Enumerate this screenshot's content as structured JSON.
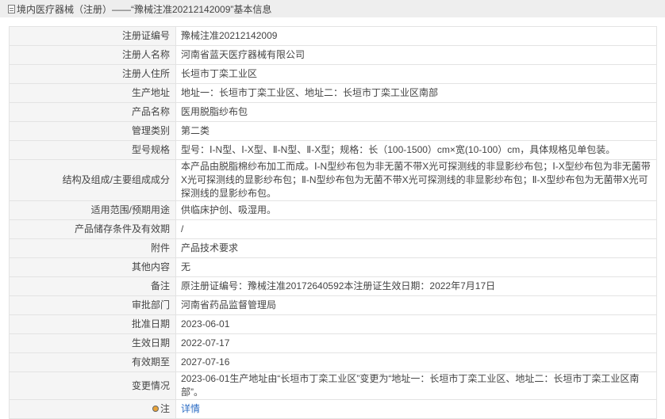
{
  "header": {
    "title": "境内医疗器械（注册）——“豫械注准20212142009”基本信息",
    "icon": "document-icon"
  },
  "rows": [
    {
      "label": "注册证编号",
      "value": "豫械注准20212142009"
    },
    {
      "label": "注册人名称",
      "value": "河南省蓝天医疗器械有限公司"
    },
    {
      "label": "注册人住所",
      "value": "长垣市丁栾工业区"
    },
    {
      "label": "生产地址",
      "value": "地址一：长垣市丁栾工业区、地址二：长垣市丁栾工业区南部"
    },
    {
      "label": "产品名称",
      "value": "医用脱脂纱布包"
    },
    {
      "label": "管理类别",
      "value": "第二类"
    },
    {
      "label": "型号规格",
      "value": "型号：Ⅰ-N型、Ⅰ-X型、Ⅱ-N型、Ⅱ-X型；规格：长（100-1500）cm×宽(10-100）cm，具体规格见单包装。"
    },
    {
      "label": "结构及组成/主要组成成分",
      "value": "本产品由脱脂棉纱布加工而成。Ⅰ-N型纱布包为非无菌不带X光可探测线的非显影纱布包；Ⅰ-X型纱布包为非无菌带X光可探测线的显影纱布包；Ⅱ-N型纱布包为无菌不带X光可探测线的非显影纱布包；Ⅱ-X型纱布包为无菌带X光可探测线的显影纱布包。"
    },
    {
      "label": "适用范围/预期用途",
      "value": "供临床护创、吸湿用。"
    },
    {
      "label": "产品储存条件及有效期",
      "value": "/"
    },
    {
      "label": "附件",
      "value": "产品技术要求"
    },
    {
      "label": "其他内容",
      "value": "无"
    },
    {
      "label": "备注",
      "value": "原注册证编号：豫械注准20172640592本注册证生效日期：2022年7月17日"
    },
    {
      "label": "审批部门",
      "value": "河南省药品监督管理局"
    },
    {
      "label": "批准日期",
      "value": "2023-06-01"
    },
    {
      "label": "生效日期",
      "value": "2022-07-17"
    },
    {
      "label": "有效期至",
      "value": "2027-07-16"
    },
    {
      "label": "变更情况",
      "value": "2023-06-01生产地址由“长垣市丁栾工业区”变更为“地址一：长垣市丁栾工业区、地址二：长垣市丁栾工业区南部”。"
    }
  ],
  "note": {
    "label": "注",
    "icon": "bulb-icon",
    "link": "详情"
  }
}
